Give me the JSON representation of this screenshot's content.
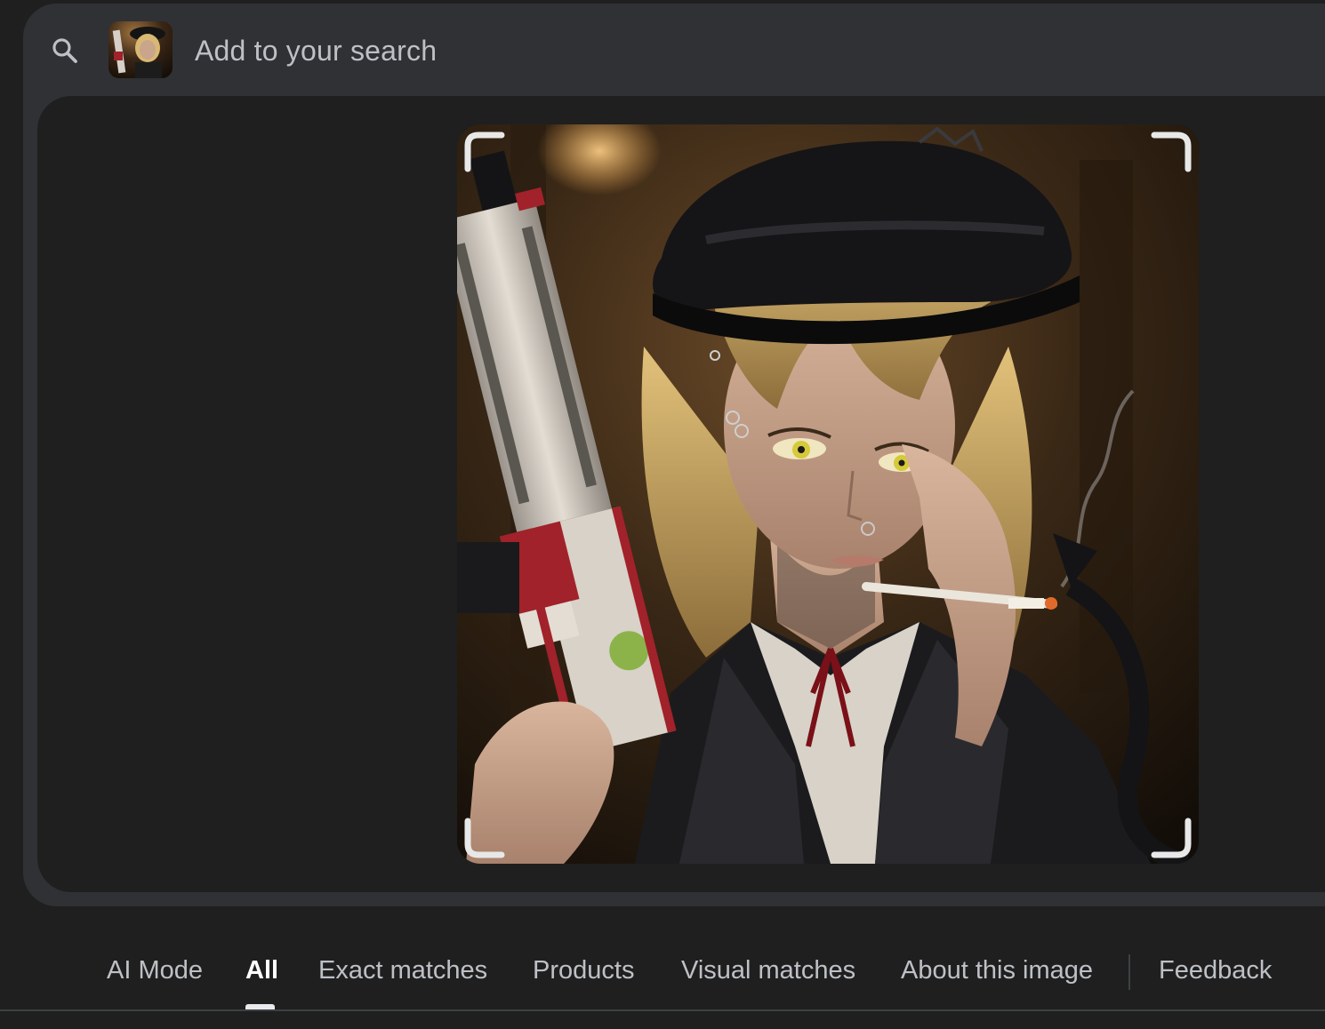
{
  "search": {
    "placeholder": "Add to your search",
    "search_icon": "search-icon",
    "thumbnail_icon": "image-thumbnail"
  },
  "tabs": [
    {
      "label": "AI Mode",
      "active": false
    },
    {
      "label": "All",
      "active": true
    },
    {
      "label": "Exact matches",
      "active": false
    },
    {
      "label": "Products",
      "active": false
    },
    {
      "label": "Visual matches",
      "active": false
    },
    {
      "label": "About this image",
      "active": false
    },
    {
      "label": "Feedback",
      "active": false
    }
  ],
  "colors": {
    "page_bg": "#1f1f1f",
    "card_bg": "#303134",
    "text_muted": "#bdc1c6",
    "text_active": "#ffffff"
  }
}
